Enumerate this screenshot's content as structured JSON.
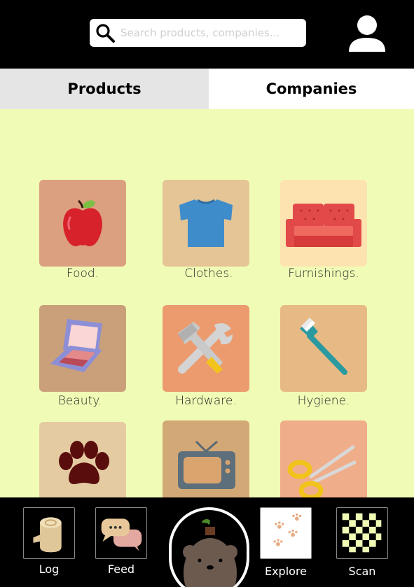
{
  "search": {
    "placeholder": "Search products, companies..."
  },
  "tabs": {
    "products": "Products",
    "companies": "Companies"
  },
  "categories": [
    {
      "label": "Food.",
      "icon": "apple-icon",
      "bg": "#dba080"
    },
    {
      "label": "Clothes.",
      "icon": "tshirt-icon",
      "bg": "#e5c595"
    },
    {
      "label": "Furnishings.",
      "icon": "sofa-icon",
      "bg": "#fde3b0"
    },
    {
      "label": "Beauty.",
      "icon": "compact-icon",
      "bg": "#c9a07a"
    },
    {
      "label": "Hardware.",
      "icon": "tools-icon",
      "bg": "#eb9b6e"
    },
    {
      "label": "Hygiene.",
      "icon": "toothbrush-icon",
      "bg": "#e7ba85"
    },
    {
      "label": "",
      "icon": "paw-icon",
      "bg": "#e5cba2"
    },
    {
      "label": "",
      "icon": "tv-icon",
      "bg": "#d3a877"
    },
    {
      "label": "",
      "icon": "scissors-icon",
      "bg": "#f0ad8a"
    }
  ],
  "nav": {
    "log": "Log",
    "feed": "Feed",
    "explore": "Explore",
    "scan": "Scan"
  }
}
